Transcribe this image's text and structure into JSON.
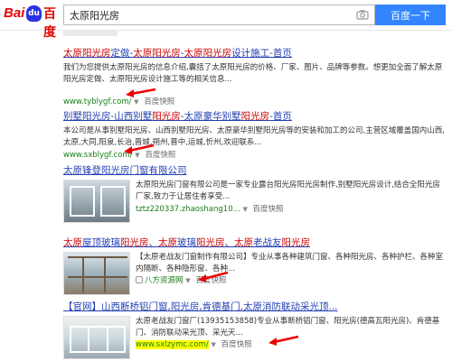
{
  "header": {
    "logo_left": "Bai",
    "logo_paw": "du",
    "logo_right": "百度",
    "search_value": "太原阳光房",
    "search_button": "百度一下"
  },
  "results": [
    {
      "title_parts": [
        "太原阳光房",
        "定做-",
        "太原阳光房",
        "-",
        "太原阳光房",
        "设计施工-首页"
      ],
      "abstract": "我们为您提供太原阳光房的信息介绍,囊括了太原阳光房的价格、厂家、图片、品牌等参数。想更加全面了解太原阳光房定做、太原阳光房设计施工等的相关信息...",
      "url": "www.tyblygf.com/",
      "snapshot": "百度快照"
    },
    {
      "title_parts": [
        "别墅阳光房",
        "-山西别墅",
        "阳光房",
        "-太原豪华别墅",
        "阳光房",
        "-首页"
      ],
      "abstract": "本公司是从事别墅阳光房、山西别墅阳光房、太原豪华别墅阳光房等的安装和加工的公司,主营区域覆盖国内山西,太原,大同,阳泉,长治,晋城,朔州,晋中,运城,忻州,欢迎联系...",
      "url": "www.sxblygf.com/",
      "snapshot": "百度快照"
    },
    {
      "title": "太原锋登阳光房门窗有限公司",
      "abstract": "太原阳光房门窗有限公司是一家专业露台阳光房阳光房制作,别墅阳光房设计,结合全阳光房厂家,致力于让居住者享受...",
      "url": "tztz220337.zhaoshang10...",
      "snapshot": "百度快照"
    },
    {
      "title_parts": [
        "太原",
        "屋顶玻璃",
        "阳光房",
        "、",
        "太原",
        "玻璃",
        "阳光房",
        "、",
        "太原",
        "老战友",
        "阳光房"
      ],
      "abstract": "【太原老战友门窗制作有限公司】专业从事各种建筑门窗、各种阳光房、各种护栏、各种室内隔断、各种隐形窗、各种...",
      "url": "八方资源网",
      "snapshot": "百度快照"
    },
    {
      "title": "【官网】山西断桥铝门窗,阳光房,肯德基门,太原消防联动采光顶...",
      "abstract": "太原老战友门窗厂(13935153858)专业从事断桥铝门窗、阳光房(德高瓦阳光房)、肯德基门、消防联动采光顶、采光天...",
      "url": "www.sxlzymc.com/",
      "snapshot": "百度快照"
    }
  ]
}
